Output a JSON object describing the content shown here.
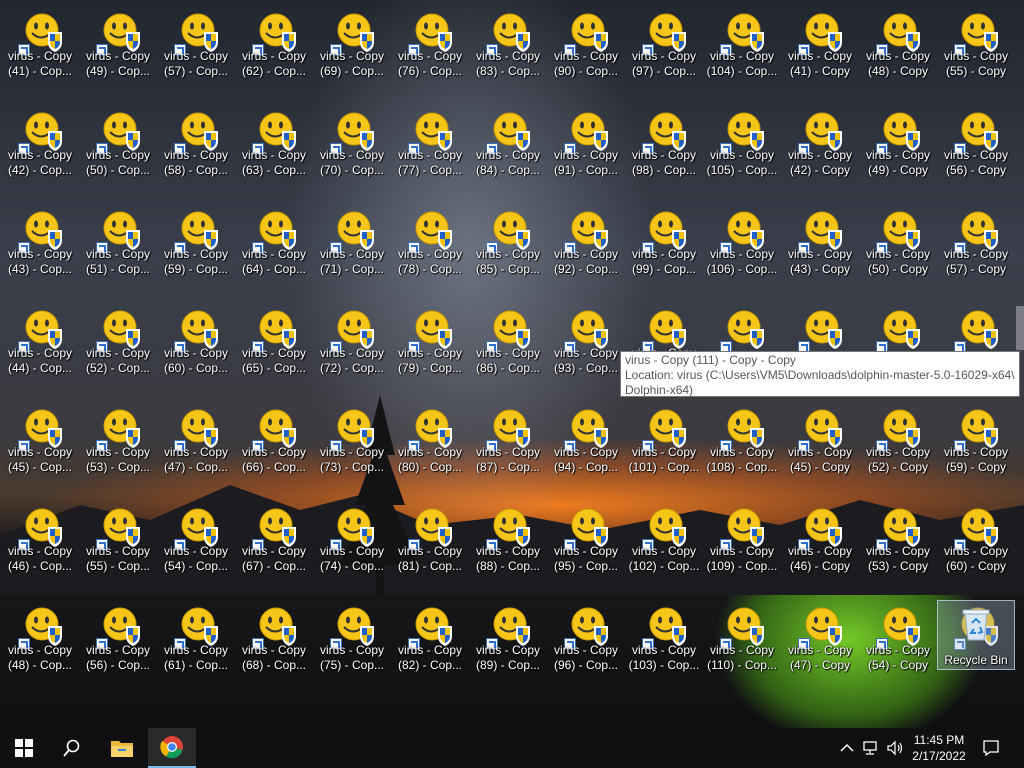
{
  "desktop": {
    "columns": [
      [
        "virus - Copy\n(41) - Cop...",
        "virus - Copy\n(42) - Cop...",
        "virus - Copy\n(43) - Cop...",
        "virus - Copy\n(44) - Cop...",
        "virus - Copy\n(45) - Cop...",
        "virus - Copy\n(46) - Cop...",
        "virus - Copy\n(48) - Cop..."
      ],
      [
        "virus - Copy\n(49) - Cop...",
        "virus - Copy\n(50) - Cop...",
        "virus - Copy\n(51) - Cop...",
        "virus - Copy\n(52) - Cop...",
        "virus - Copy\n(53) - Cop...",
        "virus - Copy\n(55) - Cop...",
        "virus - Copy\n(56) - Cop..."
      ],
      [
        "virus - Copy\n(57) - Cop...",
        "virus - Copy\n(58) - Cop...",
        "virus - Copy\n(59) - Cop...",
        "virus - Copy\n(60) - Cop...",
        "virus - Copy\n(47) - Cop...",
        "virus - Copy\n(54) - Cop...",
        "virus - Copy\n(61) - Cop..."
      ],
      [
        "virus - Copy\n(62) - Cop...",
        "virus - Copy\n(63) - Cop...",
        "virus - Copy\n(64) - Cop...",
        "virus - Copy\n(65) - Cop...",
        "virus - Copy\n(66) - Cop...",
        "virus - Copy\n(67) - Cop...",
        "virus - Copy\n(68) - Cop..."
      ],
      [
        "virus - Copy\n(69) - Cop...",
        "virus - Copy\n(70) - Cop...",
        "virus - Copy\n(71) - Cop...",
        "virus - Copy\n(72) - Cop...",
        "virus - Copy\n(73) - Cop...",
        "virus - Copy\n(74) - Cop...",
        "virus - Copy\n(75) - Cop..."
      ],
      [
        "virus - Copy\n(76) - Cop...",
        "virus - Copy\n(77) - Cop...",
        "virus - Copy\n(78) - Cop...",
        "virus - Copy\n(79) - Cop...",
        "virus - Copy\n(80) - Cop...",
        "virus - Copy\n(81) - Cop...",
        "virus - Copy\n(82) - Cop..."
      ],
      [
        "virus - Copy\n(83) - Cop...",
        "virus - Copy\n(84) - Cop...",
        "virus - Copy\n(85) - Cop...",
        "virus - Copy\n(86) - Cop...",
        "virus - Copy\n(87) - Cop...",
        "virus - Copy\n(88) - Cop...",
        "virus - Copy\n(89) - Cop..."
      ],
      [
        "virus - Copy\n(90) - Cop...",
        "virus - Copy\n(91) - Cop...",
        "virus - Copy\n(92) - Cop...",
        "virus - Copy\n(93) - Cop...",
        "virus - Copy\n(94) - Cop...",
        "virus - Copy\n(95) - Cop...",
        "virus - Copy\n(96) - Cop..."
      ],
      [
        "virus - Copy\n(97) - Cop...",
        "virus - Copy\n(98) - Cop...",
        "virus - Copy\n(99) - Cop...",
        "virus - Copy",
        "virus - Copy\n(101) - Cop...",
        "virus - Copy\n(102) - Cop...",
        "virus - Copy\n(103) - Cop..."
      ],
      [
        "virus - Copy\n(104) - Cop...",
        "virus - Copy\n(105) - Cop...",
        "virus - Copy\n(106) - Cop...",
        "",
        "virus - Copy\n(108) - Cop...",
        "virus - Copy\n(109) - Cop...",
        "virus - Copy\n(110) - Cop..."
      ],
      [
        "virus - Copy\n(41) - Copy",
        "virus - Copy\n(42) - Copy",
        "virus - Copy\n(43) - Copy",
        "",
        "virus - Copy\n(45) - Copy",
        "virus - Copy\n(46) - Copy",
        "virus - Copy\n(47) - Copy"
      ],
      [
        "virus - Copy\n(48) - Copy",
        "virus - Copy\n(49) - Copy",
        "virus - Copy\n(50) - Copy",
        "",
        "virus - Copy\n(52) - Copy",
        "virus - Copy\n(53) - Copy",
        "virus - Copy\n(54) - Copy"
      ],
      [
        "virus - Copy\n(55) - Copy",
        "virus - Copy\n(56) - Copy",
        "virus - Copy\n(57) - Copy",
        "",
        "virus - Copy\n(59) - Copy",
        "virus - Copy\n(60) - Copy",
        ""
      ]
    ],
    "recycle_bin_label": "Recycle Bin"
  },
  "tooltip": {
    "line1": "virus - Copy (111) - Copy - Copy",
    "line2": "Location: virus (C:\\Users\\VM5\\Downloads\\dolphin-master-5.0-16029-x64\\",
    "line3": "Dolphin-x64)"
  },
  "taskbar": {
    "time": "11:45 PM",
    "date": "2/17/2022",
    "pinned": [
      "windows-start-icon",
      "search-icon",
      "file-explorer-icon",
      "chrome-icon"
    ],
    "tray": [
      "chevron-up-icon",
      "network-icon",
      "volume-icon",
      "notification-icon"
    ]
  },
  "colors": {
    "taskbar": "#101010",
    "tooltip_bg": "#ffffff",
    "face_yellow": "#f5c518",
    "shield_blue": "#1f5fc7",
    "shield_yellow": "#f2c200"
  }
}
